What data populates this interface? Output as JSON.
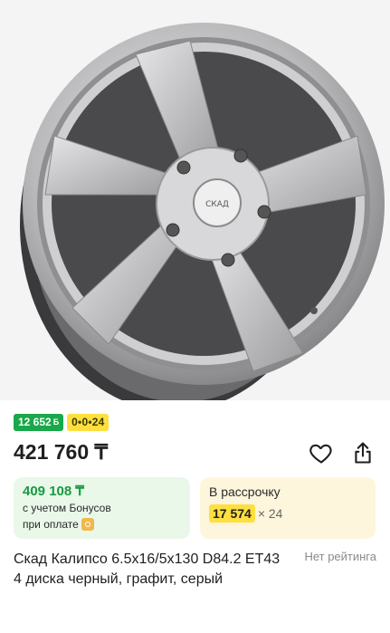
{
  "product": {
    "image_alt": "Скад Калипсо wheel",
    "hub_logo": "СКАД"
  },
  "badges": {
    "bonus": "12 652",
    "bonus_currency": "Б",
    "installment": "0•0•24"
  },
  "price": {
    "main": "421 760 ₸"
  },
  "actions": {
    "favorite_icon": "heart-icon",
    "share_icon": "share-icon"
  },
  "bonus_card": {
    "price": "409 108 ₸",
    "line1": "с учетом Бонусов",
    "line2": "при оплате"
  },
  "credit_card": {
    "title": "В рассрочку",
    "amount": "17 574",
    "months": "× 24"
  },
  "title": "Скад Калипсо 6.5x16/5x130 D84.2 ET43 4 диска черный, графит, серый",
  "rating": "Нет рейтинга",
  "colors": {
    "green": "#19a84a",
    "yellow": "#ffdf3f",
    "bonus_bg": "#e9f8e9",
    "credit_bg": "#fdf6dc"
  }
}
